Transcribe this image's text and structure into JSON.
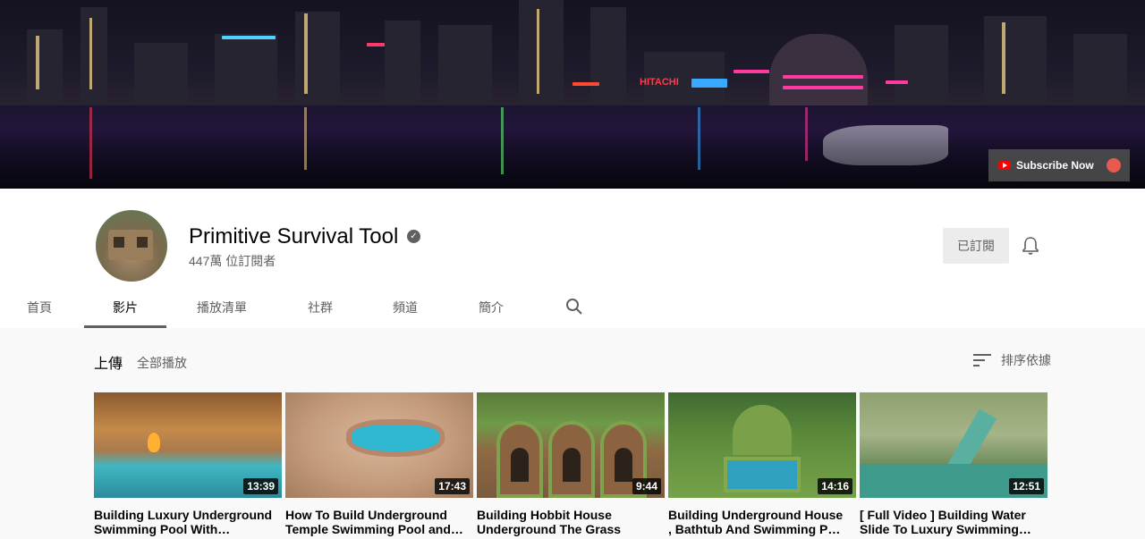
{
  "banner": {
    "subscribe_overlay_label": "Subscribe Now",
    "neon_sign": "HITACHI"
  },
  "channel": {
    "name": "Primitive Survival Tool",
    "subscribers": "447萬 位訂閱者",
    "subscribed_label": "已訂閱",
    "verified_icon": "check-circle-icon"
  },
  "tabs": [
    {
      "label": "首頁",
      "active": false
    },
    {
      "label": "影片",
      "active": true
    },
    {
      "label": "播放清單",
      "active": false
    },
    {
      "label": "社群",
      "active": false
    },
    {
      "label": "頻道",
      "active": false
    },
    {
      "label": "簡介",
      "active": false
    }
  ],
  "section": {
    "title": "上傳",
    "play_all": "全部播放",
    "sort_label": "排序依據"
  },
  "videos": [
    {
      "title_line1": "Building Luxury Underground",
      "title_line2": "Swimming Pool With…",
      "duration": "13:39"
    },
    {
      "title_line1": "How To Build Underground",
      "title_line2": "Temple Swimming Pool and…",
      "duration": "17:43"
    },
    {
      "title_line1": "Building Hobbit House",
      "title_line2": "Underground The Grass",
      "duration": "9:44"
    },
    {
      "title_line1": "Building Underground House",
      "title_line2": ", Bathtub And Swimming Po…",
      "duration": "14:16"
    },
    {
      "title_line1": "[ Full Video ] Building Water",
      "title_line2": "Slide To Luxury Swimming…",
      "duration": "12:51"
    }
  ],
  "colors": {
    "header_bg": "#ffffff",
    "content_bg": "#f9f9f9",
    "subscribed_bg": "#ececec",
    "text_primary": "#030303",
    "text_secondary": "#606060",
    "youtube_red": "#ff0000"
  }
}
